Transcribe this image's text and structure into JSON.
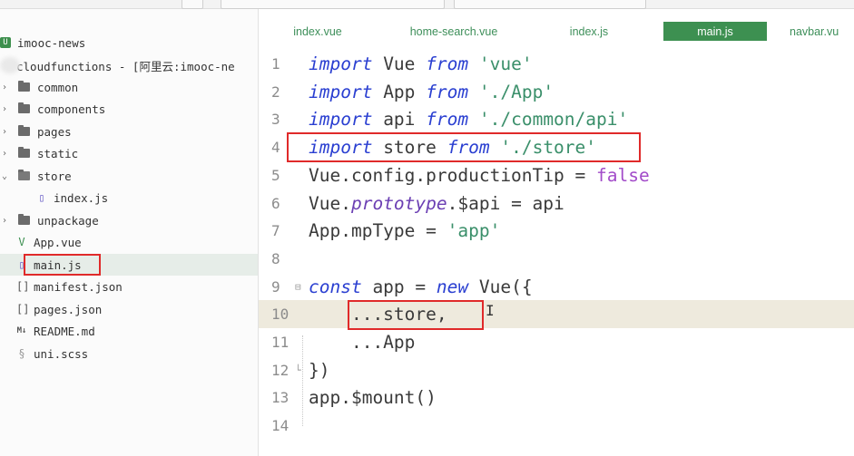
{
  "sidebar": {
    "root": "imooc-news",
    "items": [
      {
        "label": "cloudfunctions - [阿里云:imooc-ne",
        "type": "folder"
      },
      {
        "label": "common",
        "type": "folder"
      },
      {
        "label": "components",
        "type": "folder"
      },
      {
        "label": "pages",
        "type": "folder"
      },
      {
        "label": "static",
        "type": "folder"
      },
      {
        "label": "store",
        "type": "folder-open"
      },
      {
        "label": "index.js",
        "type": "js-file"
      },
      {
        "label": "unpackage",
        "type": "folder"
      },
      {
        "label": "App.vue",
        "type": "vue-file"
      },
      {
        "label": "main.js",
        "type": "js-file"
      },
      {
        "label": "manifest.json",
        "type": "json-file"
      },
      {
        "label": "pages.json",
        "type": "json-file"
      },
      {
        "label": "README.md",
        "type": "md-file"
      },
      {
        "label": "uni.scss",
        "type": "scss-file"
      }
    ]
  },
  "tabs": [
    {
      "label": "index.vue"
    },
    {
      "label": "home-search.vue"
    },
    {
      "label": "index.js"
    },
    {
      "label": "main.js",
      "active": true
    },
    {
      "label": "navbar.vu"
    }
  ],
  "editor": {
    "lines": [
      {
        "n": "1",
        "tokens": [
          [
            "kw",
            "import"
          ],
          [
            "p",
            " Vue "
          ],
          [
            "kw",
            "from"
          ],
          [
            "p",
            " "
          ],
          [
            "str",
            "'vue'"
          ]
        ]
      },
      {
        "n": "2",
        "tokens": [
          [
            "kw",
            "import"
          ],
          [
            "p",
            " App "
          ],
          [
            "kw",
            "from"
          ],
          [
            "p",
            " "
          ],
          [
            "str",
            "'./App'"
          ]
        ]
      },
      {
        "n": "3",
        "tokens": [
          [
            "kw",
            "import"
          ],
          [
            "p",
            " api "
          ],
          [
            "kw",
            "from"
          ],
          [
            "p",
            " "
          ],
          [
            "str",
            "'./common/api'"
          ]
        ]
      },
      {
        "n": "4",
        "tokens": [
          [
            "kw",
            "import"
          ],
          [
            "p",
            " store "
          ],
          [
            "kw",
            "from"
          ],
          [
            "p",
            " "
          ],
          [
            "str",
            "'./store'"
          ]
        ]
      },
      {
        "n": "5",
        "tokens": [
          [
            "p",
            "Vue.config.productionTip = "
          ],
          [
            "bool",
            "false"
          ]
        ]
      },
      {
        "n": "6",
        "tokens": [
          [
            "p",
            "Vue."
          ],
          [
            "prop",
            "prototype"
          ],
          [
            "p",
            ".$api = api"
          ]
        ]
      },
      {
        "n": "7",
        "tokens": [
          [
            "p",
            "App.mpType = "
          ],
          [
            "str",
            "'app'"
          ]
        ]
      },
      {
        "n": "8",
        "tokens": []
      },
      {
        "n": "9",
        "tokens": [
          [
            "kw",
            "const"
          ],
          [
            "p",
            " app = "
          ],
          [
            "kw",
            "new"
          ],
          [
            "p",
            " Vue({"
          ]
        ],
        "fold": "⊟"
      },
      {
        "n": "10",
        "tokens": [
          [
            "p",
            "    ...store,"
          ]
        ],
        "current": true
      },
      {
        "n": "11",
        "tokens": [
          [
            "p",
            "    ...App"
          ]
        ]
      },
      {
        "n": "12",
        "tokens": [
          [
            "p",
            "})"
          ]
        ],
        "fold": "└"
      },
      {
        "n": "13",
        "tokens": [
          [
            "p",
            "app.$mount()"
          ]
        ]
      },
      {
        "n": "14",
        "tokens": []
      }
    ]
  },
  "icons": {
    "folder": "folder-icon",
    "js": "js-file-icon",
    "vue": "vue-file-icon",
    "json": "json-file-icon",
    "md": "markdown-file-icon",
    "scss": "scss-file-icon"
  },
  "colors": {
    "accent": "#3d9051",
    "keyword": "#2a3fd1",
    "string": "#3a8f6a",
    "highlight": "#e02a2a"
  }
}
